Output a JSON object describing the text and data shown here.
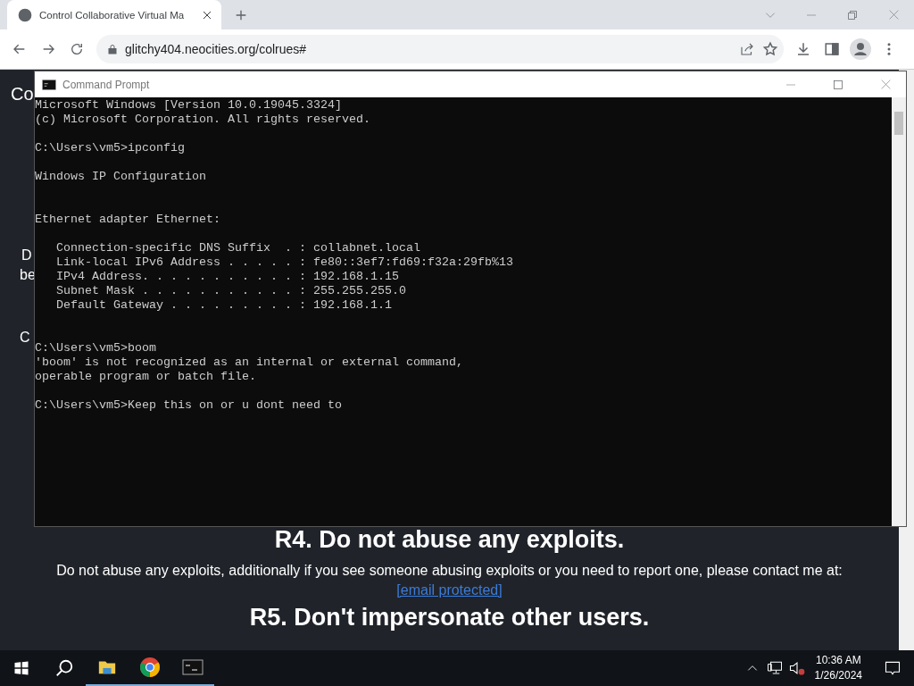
{
  "browser": {
    "tabs": [
      {
        "title": "Control Collaborative Virtual Ma",
        "selected": true
      }
    ],
    "address": "glitchy404.neocities.org/colrues#"
  },
  "page": {
    "fragments": [
      {
        "kind": "heading",
        "text": "Co"
      },
      {
        "kind": "text",
        "text": "D"
      },
      {
        "kind": "text",
        "text": "be"
      },
      {
        "kind": "text",
        "text": "C"
      }
    ],
    "sections": [
      {
        "heading": "R4. Do not abuse any exploits.",
        "body": "Do not abuse any exploits, additionally if you see someone abusing exploits or you need to report one, please contact me at:",
        "link": "[email protected]"
      },
      {
        "heading": "R5. Don't impersonate other users."
      }
    ]
  },
  "console": {
    "title": "Command Prompt",
    "blocks": [
      {
        "lines": [
          "Microsoft Windows [Version 10.0.19045.3324]",
          "(c) Microsoft Corporation. All rights reserved."
        ],
        "double_gap": false
      },
      {
        "lines": [
          "C:\\Users\\vm5>ipconfig"
        ],
        "double_gap": false
      },
      {
        "lines": [
          "Windows IP Configuration"
        ],
        "double_gap": true
      },
      {
        "lines": [
          "Ethernet adapter Ethernet:"
        ],
        "double_gap": false
      },
      {
        "lines": [
          "   Connection-specific DNS Suffix  . : collabnet.local",
          "   Link-local IPv6 Address . . . . . : fe80::3ef7:fd69:f32a:29fb%13",
          "   IPv4 Address. . . . . . . . . . . : 192.168.1.15",
          "   Subnet Mask . . . . . . . . . . . : 255.255.255.0",
          "   Default Gateway . . . . . . . . . : 192.168.1.1"
        ],
        "double_gap": true
      },
      {
        "lines": [
          "C:\\Users\\vm5>boom",
          "'boom' is not recognized as an internal or external command,",
          "operable program or batch file."
        ],
        "double_gap": false
      },
      {
        "lines": [
          "C:\\Users\\vm5>Keep this on or u dont need to"
        ],
        "double_gap": false
      }
    ]
  },
  "taskbar": {
    "time": "10:36 AM",
    "date": "1/26/2024"
  }
}
